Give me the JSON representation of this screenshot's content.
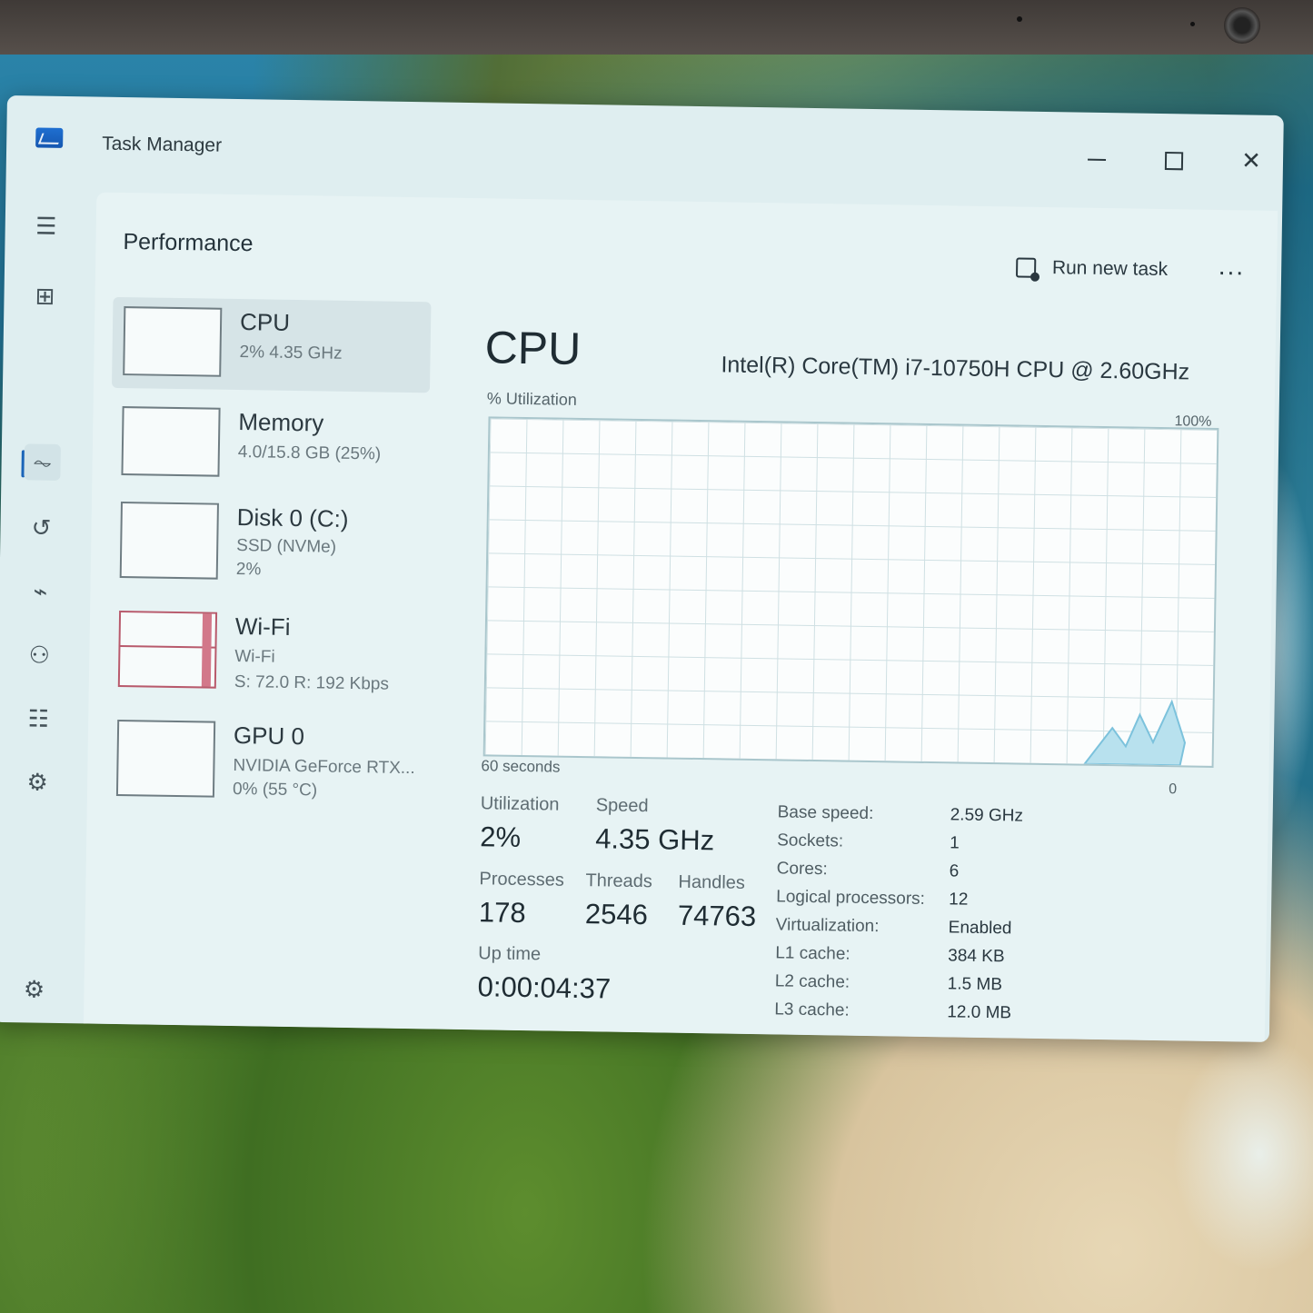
{
  "window": {
    "title": "Task Manager"
  },
  "header": {
    "page_title": "Performance",
    "run_new_task": "Run new task",
    "more": "..."
  },
  "devices": [
    {
      "name": "CPU",
      "line1": "2% 4.35 GHz",
      "line2": ""
    },
    {
      "name": "Memory",
      "line1": "4.0/15.8 GB (25%)",
      "line2": ""
    },
    {
      "name": "Disk 0 (C:)",
      "line1": "SSD (NVMe)",
      "line2": "2%"
    },
    {
      "name": "Wi-Fi",
      "line1": "Wi-Fi",
      "line2": "S: 72.0 R: 192 Kbps"
    },
    {
      "name": "GPU 0",
      "line1": "NVIDIA GeForce RTX...",
      "line2": "0% (55 °C)"
    }
  ],
  "cpu": {
    "title": "CPU",
    "model": "Intel(R) Core(TM) i7-10750H CPU @ 2.60GHz",
    "util_label": "% Utilization",
    "max_label": "100%",
    "time_label": "60 seconds",
    "min_label": "0",
    "utilization_label": "Utilization",
    "utilization": "2%",
    "speed_label": "Speed",
    "speed": "4.35 GHz",
    "processes_label": "Processes",
    "processes": "178",
    "threads_label": "Threads",
    "threads": "2546",
    "handles_label": "Handles",
    "handles": "74763",
    "uptime_label": "Up time",
    "uptime": "0:00:04:37",
    "specs": [
      {
        "k": "Base speed:",
        "v": "2.59 GHz"
      },
      {
        "k": "Sockets:",
        "v": "1"
      },
      {
        "k": "Cores:",
        "v": "6"
      },
      {
        "k": "Logical processors:",
        "v": "12"
      },
      {
        "k": "Virtualization:",
        "v": "Enabled"
      },
      {
        "k": "L1 cache:",
        "v": "384 KB"
      },
      {
        "k": "L2 cache:",
        "v": "1.5 MB"
      },
      {
        "k": "L3 cache:",
        "v": "12.0 MB"
      }
    ]
  },
  "nav_icons": [
    "hamburger-menu-icon",
    "processes-icon",
    "performance-icon",
    "app-history-icon",
    "startup-apps-icon",
    "users-icon",
    "details-icon",
    "services-icon",
    "settings-icon"
  ]
}
